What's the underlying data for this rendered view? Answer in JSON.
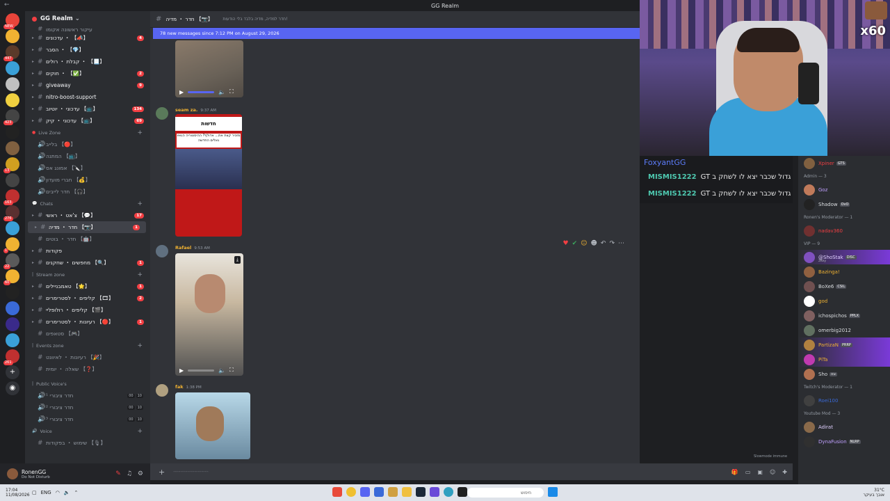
{
  "window": {
    "title": "GG Realm"
  },
  "servers": [
    {
      "color": "#e8443a",
      "badge": "NEW"
    },
    {
      "color": "#f0b232",
      "badge": ""
    },
    {
      "color": "#5a3a2a",
      "badge": "447"
    },
    {
      "color": "#3aa0d8",
      "badge": ""
    },
    {
      "color": "#c0c0c0",
      "badge": ""
    },
    {
      "color": "#f0d040",
      "badge": ""
    },
    {
      "color": "#444",
      "badge": "423"
    },
    {
      "color": "#222",
      "badge": ""
    },
    {
      "color": "#806040",
      "badge": ""
    },
    {
      "color": "#d0a020",
      "badge": "13"
    },
    {
      "color": "#444",
      "badge": ""
    },
    {
      "color": "#c03030",
      "badge": "163"
    },
    {
      "color": "#5a3030",
      "badge": "276"
    },
    {
      "color": "#3aa0d8",
      "badge": ""
    },
    {
      "color": "#f0b232",
      "badge": "1"
    },
    {
      "color": "#5a5a5a",
      "badge": "22"
    },
    {
      "color": "#f0b232",
      "badge": "60"
    },
    {
      "color": "#222",
      "badge": ""
    },
    {
      "color": "#3a6ad8",
      "badge": ""
    },
    {
      "color": "#3a2a8a",
      "badge": ""
    },
    {
      "color": "#3aa0d8",
      "badge": ""
    },
    {
      "color": "#c03030",
      "badge": "261"
    }
  ],
  "guild": {
    "name": "GG Realm"
  },
  "channels": {
    "top_partial": "עיקור ראשונה אקומו",
    "list_a": [
      {
        "name": "עדכונים ・ 【📣】",
        "count": "4",
        "unread": true
      },
      {
        "name": "הסבר ・ 【💎】",
        "count": "",
        "unread": true
      },
      {
        "name": "קבלת ・ רולים ・ 【📃】",
        "count": "",
        "unread": true
      },
      {
        "name": "חוקים ・ 【✅】",
        "count": "2",
        "unread": true
      },
      {
        "name": "giveaway",
        "count": "9",
        "unread": true
      },
      {
        "name": "nitro-boost-support",
        "count": "",
        "unread": true
      },
      {
        "name": "עדכוני ・ יוטיוב 【📺】",
        "count": "134",
        "unread": true
      },
      {
        "name": "עדכוני ・ קיק 【📺】",
        "count": "69",
        "unread": true
      }
    ],
    "cat_live": "Live Zone",
    "list_live": [
      {
        "name": "בלייב 【🔴】"
      },
      {
        "name": "המתנה 【📺】"
      },
      {
        "name": "אמונג אס 【🔪】"
      },
      {
        "name": "חברי מועדון 【💰】"
      },
      {
        "name": "חדר לייבים 【🎧】"
      }
    ],
    "cat_chats": "Chats",
    "list_chats": [
      {
        "name": "צ'אט ・ ראשי 【💬】",
        "count": "17",
        "unread": true,
        "sel": false
      },
      {
        "name": "חדר ・ מדיה 【📷】",
        "count": "1",
        "unread": true,
        "sel": true
      },
      {
        "name": "חדר ・ בוטים 【🤖】",
        "count": "",
        "unread": false,
        "sel": false
      },
      {
        "name": "פקודות",
        "count": "",
        "unread": true,
        "sel": false
      },
      {
        "name": "מחפשים ・ שחקנים 【🔍】",
        "count": "1",
        "unread": true,
        "sel": false
      }
    ],
    "cat_stream": "Stream zone",
    "list_stream": [
      {
        "name": "טאמבניילים 【🌟】",
        "count": "1",
        "unread": true
      },
      {
        "name": "קליפים ・ לסטרימרים 【🎞】",
        "count": "2",
        "unread": true
      },
      {
        "name": "קליפים ・ רולופליי 【🎬】",
        "count": "",
        "unread": true
      },
      {
        "name": "רעיונות ・ לסטרימרים 【🔴】",
        "count": "1",
        "unread": true
      },
      {
        "name": "סטאפים 【🎮】",
        "count": "",
        "unread": false
      }
    ],
    "cat_events": "Events zone",
    "list_events": [
      {
        "name": "רעיונות ・ לאיוונט 【🎉】"
      },
      {
        "name": "שאלה ・ יומית 【❓】"
      }
    ],
    "cat_public": "Public Voice's",
    "list_public": [
      {
        "name": "חדר ציבורי ¹",
        "a": "00",
        "b": "10"
      },
      {
        "name": "חדר ציבורי ²",
        "a": "00",
        "b": "10"
      },
      {
        "name": "חדר ציבורי ³",
        "a": "00",
        "b": "10"
      }
    ],
    "cat_voice": "Voice",
    "list_voice": [
      {
        "name": "שימוש ・ בפקודות 【🎙】"
      }
    ]
  },
  "user": {
    "name": "RonenGG",
    "status": "Do Not Disturb"
  },
  "chat": {
    "header_name": "חדר ・ מדיה 【📷】",
    "topic": "חדר למדיה, מדיה בלבד בלי הודעות!",
    "new_messages": "78 new messages since 7:12 PM on August 29, 2026",
    "messages": [
      {
        "name": "seam za.",
        "time": "9:37 AM",
        "color": "#5a7a5a",
        "news_title": "חדשות",
        "news_text": "מזכיר קצת את... אדולף? ההיסטוריה הגאיו נאלים החדשה"
      },
      {
        "name": "Rafael",
        "time": "9:53 AM",
        "color": "#607080"
      },
      {
        "name": "fak",
        "time": "1:38 PM",
        "color": "#b0a080"
      }
    ],
    "input_placeholder": "--------------------",
    "slowmode": "Slowmode immune"
  },
  "stream": {
    "multiplier": "x60"
  },
  "twitch_chat": {
    "top_user": "FoxyantGG",
    "lines": [
      {
        "user": "MISMIS1222",
        "text": "רונן לדעתך יש איזה יוטיובר גדול שכבר יצא לו לשחק ב GT"
      },
      {
        "user": "MISMIS1222",
        "text": "רונן לדעתך יש איזה יוטיובר גדול שכבר יצא לו לשחק ב GT"
      }
    ]
  },
  "members": {
    "top": {
      "name": "Xpiner",
      "tag": "GTS"
    },
    "role_admin": "Admin — 3",
    "admins": [
      {
        "name": "Goz",
        "color": "#c0a0ff",
        "av": "#c07a5a"
      },
      {
        "name": "Shadow",
        "tag": "OvO",
        "color": "#dbdee1",
        "av": "#222"
      }
    ],
    "role_mod": "Ronen's Moderator — 1",
    "mods": [
      {
        "name": "nadav360",
        "color": "#f23f43",
        "av": "#703030"
      }
    ],
    "role_vip": "VIP — 9",
    "vips": [
      {
        "name": "@ShoStak",
        "tag": "DISC",
        "sub": "2Key",
        "color": "#e0d0ff",
        "av": "#8050c0",
        "hl": true
      },
      {
        "name": "Bazinga!",
        "color": "#f0b232",
        "av": "#906040",
        "hl": false
      },
      {
        "name": "BoXe6",
        "tag": "CSIL",
        "color": "#dbdee1",
        "av": "#705050",
        "hl": false
      },
      {
        "name": "god",
        "color": "#f0b232",
        "av": "#fff",
        "hl": false
      },
      {
        "name": "ichospichos",
        "tag": "PPLX",
        "color": "#dbdee1",
        "av": "#806060",
        "hl": false
      },
      {
        "name": "omerbig2012",
        "color": "#dbdee1",
        "av": "#607060",
        "hl": false
      },
      {
        "name": "PartizaN",
        "tag": "PRRP",
        "color": "#f0b232",
        "av": "#b08040",
        "hl": true
      },
      {
        "name": "PiTa",
        "color": "#f0b232",
        "av": "#c03ab0",
        "hl": true
      },
      {
        "name": "Sho",
        "tag": "אזז",
        "color": "#dbdee1",
        "av": "#b07050",
        "hl": false
      }
    ],
    "role_twitch": "Twitch's Moderator — 1",
    "twitch_mods": [
      {
        "name": "Roei100",
        "color": "#3a6ad8",
        "av": "#404040"
      }
    ],
    "role_yt": "Youtube Mod — 3",
    "yt_mods": [
      {
        "name": "Adirat",
        "color": "#e0d0ff",
        "av": "#8a6a4a"
      },
      {
        "name": "DynaFusion",
        "tag": "NLRP",
        "color": "#c0a0ff",
        "av": "#303030"
      }
    ]
  },
  "taskbar": {
    "time": "17:04",
    "date": "11/08/2026",
    "lang": "ENG",
    "search": "חיפוש",
    "weather": "31°C",
    "weather_desc": "אובך בעיקר"
  }
}
